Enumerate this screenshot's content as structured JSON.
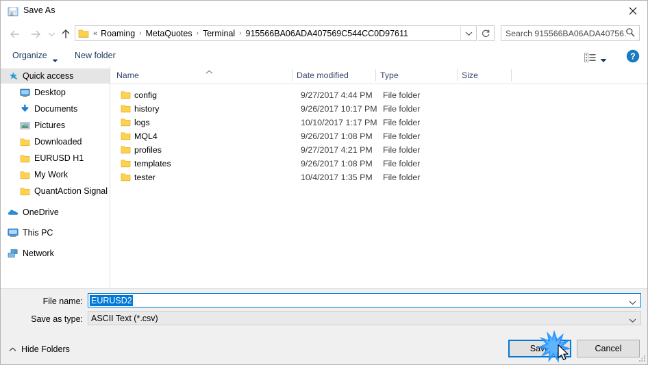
{
  "window": {
    "title": "Save As",
    "icon": "save-as-app-icon",
    "close_label": "✕"
  },
  "nav": {
    "back_icon": "arrow-left-icon",
    "forward_icon": "arrow-right-icon",
    "recent_icon": "chevron-down-icon",
    "up_icon": "arrow-up-icon",
    "address": {
      "folder_icon": "folder-icon",
      "overflow": "«",
      "crumbs": [
        "Roaming",
        "MetaQuotes",
        "Terminal",
        "915566BA06ADA407569C544CC0D97611"
      ],
      "separator": "›",
      "dropdown_icon": "chevron-down-icon"
    },
    "refresh_icon": "refresh-icon",
    "search": {
      "placeholder": "Search 915566BA06ADA40756...",
      "icon": "search-icon"
    }
  },
  "commandbar": {
    "organize": "Organize",
    "organize_caret": "▾",
    "new_folder": "New folder",
    "view_icon": "list-view-icon",
    "view_caret": "▾",
    "help_icon": "help-question-icon"
  },
  "sidebar": {
    "items": [
      {
        "label": "Quick access",
        "icon": "star-pin-icon",
        "depth": 0,
        "selected": true,
        "pinned": false
      },
      {
        "label": "Desktop",
        "icon": "desktop-icon",
        "depth": 1,
        "selected": false,
        "pinned": true
      },
      {
        "label": "Documents",
        "icon": "documents-icon",
        "depth": 1,
        "selected": false,
        "pinned": true
      },
      {
        "label": "Pictures",
        "icon": "pictures-icon",
        "depth": 1,
        "selected": false,
        "pinned": true
      },
      {
        "label": "Downloaded",
        "icon": "folder-icon",
        "depth": 1,
        "selected": false,
        "pinned": false
      },
      {
        "label": "EURUSD H1",
        "icon": "folder-icon",
        "depth": 1,
        "selected": false,
        "pinned": false
      },
      {
        "label": "My Work",
        "icon": "folder-icon",
        "depth": 1,
        "selected": false,
        "pinned": false
      },
      {
        "label": "QuantAction Signal",
        "icon": "folder-icon",
        "depth": 1,
        "selected": false,
        "pinned": false
      },
      {
        "label": "OneDrive",
        "icon": "onedrive-icon",
        "depth": 0,
        "selected": false,
        "pinned": false
      },
      {
        "label": "This PC",
        "icon": "thispc-icon",
        "depth": 0,
        "selected": false,
        "pinned": false
      },
      {
        "label": "Network",
        "icon": "network-icon",
        "depth": 0,
        "selected": false,
        "pinned": false
      }
    ]
  },
  "filelist": {
    "columns": [
      {
        "key": "name",
        "label": "Name"
      },
      {
        "key": "date",
        "label": "Date modified"
      },
      {
        "key": "type",
        "label": "Type"
      },
      {
        "key": "size",
        "label": "Size"
      }
    ],
    "sort_column": "name",
    "sort_direction": "ascending",
    "sort_icon": "caret-up-icon",
    "rows": [
      {
        "name": "config",
        "date": "9/27/2017 4:44 PM",
        "type": "File folder",
        "size": "",
        "icon": "folder-icon"
      },
      {
        "name": "history",
        "date": "9/26/2017 10:17 PM",
        "type": "File folder",
        "size": "",
        "icon": "folder-icon"
      },
      {
        "name": "logs",
        "date": "10/10/2017 1:17 PM",
        "type": "File folder",
        "size": "",
        "icon": "folder-icon"
      },
      {
        "name": "MQL4",
        "date": "9/26/2017 1:08 PM",
        "type": "File folder",
        "size": "",
        "icon": "folder-icon"
      },
      {
        "name": "profiles",
        "date": "9/27/2017 4:21 PM",
        "type": "File folder",
        "size": "",
        "icon": "folder-icon"
      },
      {
        "name": "templates",
        "date": "9/26/2017 1:08 PM",
        "type": "File folder",
        "size": "",
        "icon": "folder-icon"
      },
      {
        "name": "tester",
        "date": "10/4/2017 1:35 PM",
        "type": "File folder",
        "size": "",
        "icon": "folder-icon"
      }
    ]
  },
  "bottom": {
    "filename_label": "File name:",
    "filename_value": "EURUSD2",
    "filename_selected": true,
    "filename_caret": "˅",
    "savetype_label": "Save as type:",
    "savetype_value": "ASCII Text (*.csv)",
    "savetype_caret": "˅",
    "hide_folders_label": "Hide Folders",
    "hide_folders_caret": "˄",
    "save_label": "Save",
    "cancel_label": "Cancel"
  },
  "colors": {
    "accent": "#0078d7",
    "folder_yellow": "#ffd24d",
    "panel_gray": "#f0f0f0",
    "selection_gray": "#e5e5e5",
    "header_text": "#33456b"
  }
}
